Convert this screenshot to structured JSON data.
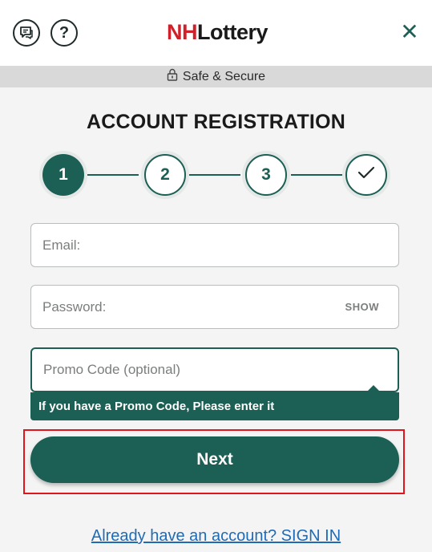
{
  "header": {
    "logo_nh": "NH",
    "logo_rest": "Lottery",
    "chat_icon": "chat-icon",
    "help_icon": "help-icon",
    "help_glyph": "?",
    "close_icon": "close-icon",
    "close_glyph": "✕"
  },
  "secure": {
    "icon": "lock-icon",
    "label": "Safe & Secure"
  },
  "page": {
    "title": "ACCOUNT REGISTRATION"
  },
  "stepper": {
    "steps": [
      {
        "label": "1",
        "state": "active"
      },
      {
        "label": "2",
        "state": "todo"
      },
      {
        "label": "3",
        "state": "todo"
      },
      {
        "label": "",
        "state": "todo",
        "icon": "check-icon"
      }
    ]
  },
  "form": {
    "email_placeholder": "Email:",
    "password_placeholder": "Password:",
    "show_label": "SHOW",
    "promo_placeholder": "Promo Code (optional)",
    "promo_tooltip": "If you have a Promo Code, Please enter it",
    "next_label": "Next"
  },
  "footer": {
    "signin_link": "Already have an account? SIGN IN"
  },
  "colors": {
    "brand_green": "#1c5f54",
    "brand_red": "#d0202a",
    "link_blue": "#1e6bb8",
    "highlight_red": "#e1161d"
  }
}
